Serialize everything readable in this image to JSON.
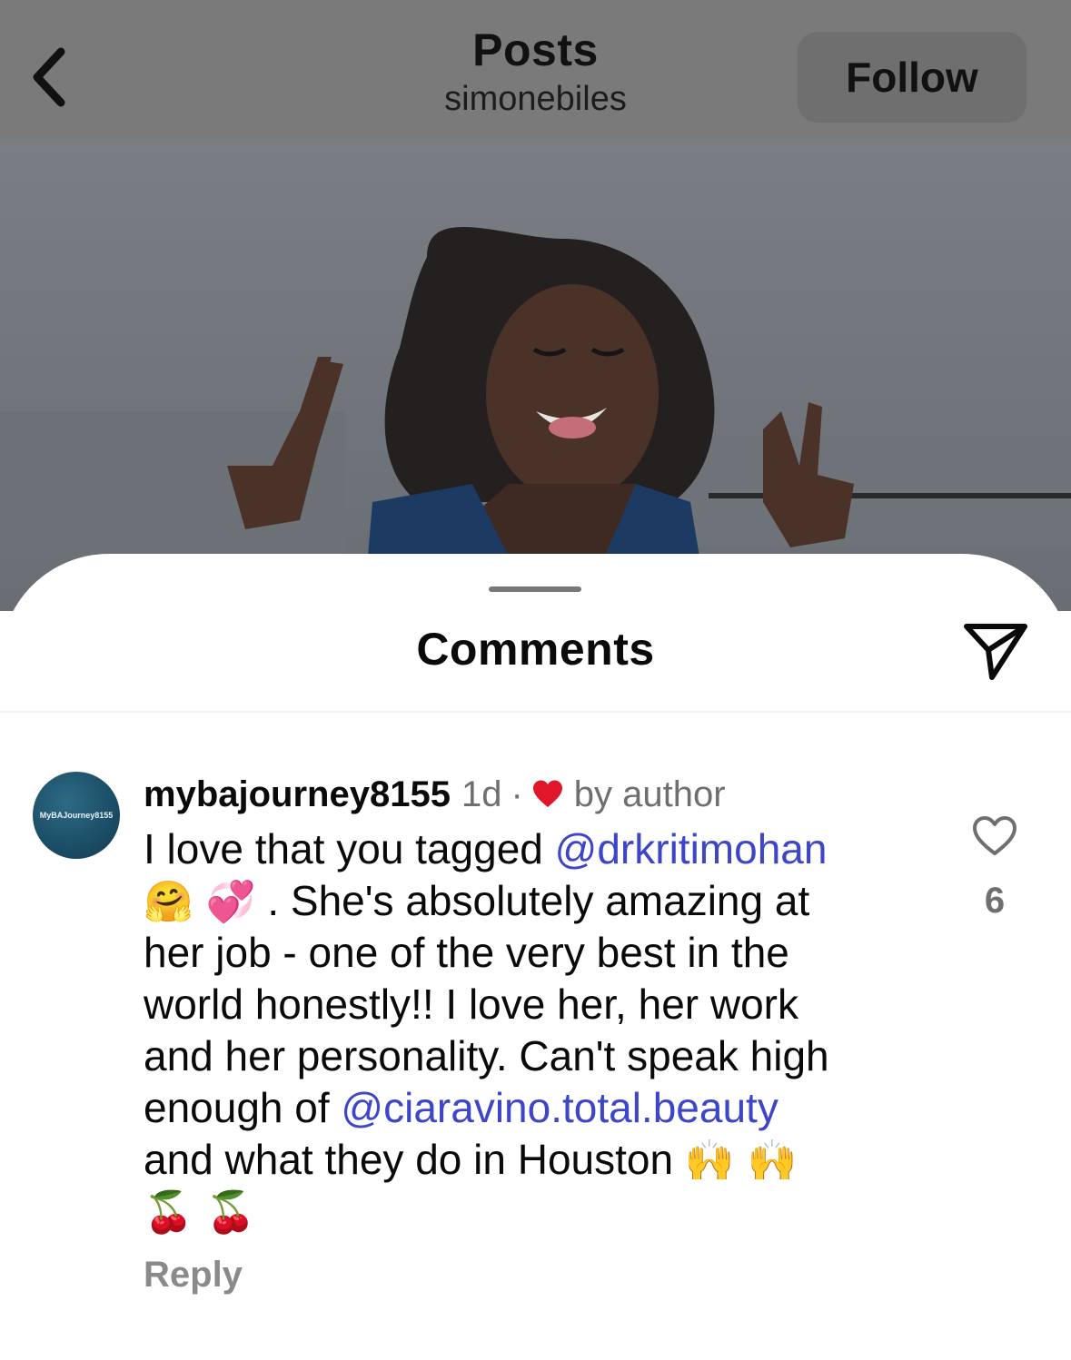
{
  "header": {
    "title": "Posts",
    "subtitle": "simonebiles",
    "follow_label": "Follow"
  },
  "comments_sheet": {
    "title": "Comments"
  },
  "comment": {
    "avatar_text": "MyBAJourney8155",
    "username": "mybajourney8155",
    "time": "1d",
    "separator": "·",
    "liked_by_author_label": "by author",
    "body": {
      "line1_text": "I love that you tagged ",
      "mention1": "@drkritimohan",
      "line2_emoji": "🤗 💞",
      "line2_text": " . She's absolutely amazing at",
      "line3": "her job - one of the very best in the",
      "line4": "world honestly!! I love her, her work",
      "line5": "and her personality. Can't speak high",
      "line6_text": "enough of ",
      "mention2": "@ciaravino.total.beauty",
      "line7_text": "and what they do in Houston ",
      "line7_emoji": "🙌 🙌",
      "line8_emoji": "🍒 🍒"
    },
    "like_count": "6",
    "reply_label": "Reply"
  },
  "colors": {
    "mention": "#3d45c9",
    "heart_red": "#e0162b",
    "muted_text": "#6f6f6f",
    "dim_overlay": "#7a7a7a"
  },
  "icons": {
    "back": "chevron-left-icon",
    "share": "paper-plane-icon",
    "like": "heart-outline-icon",
    "liked_by_author": "heart-filled-icon"
  }
}
